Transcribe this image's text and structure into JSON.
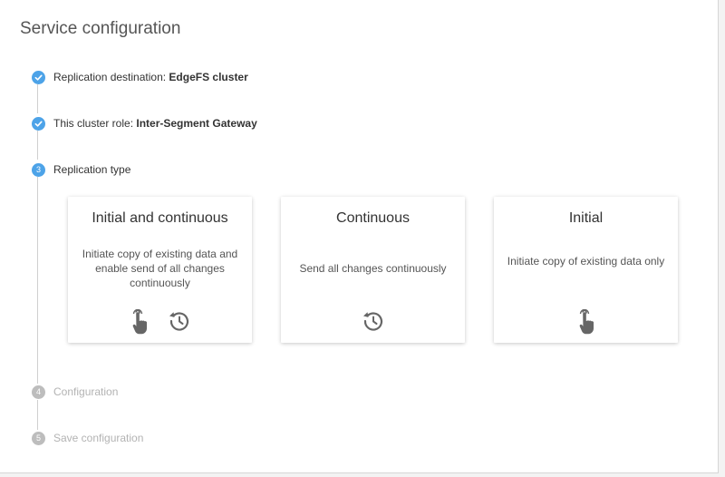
{
  "page": {
    "title": "Service configuration"
  },
  "steps": [
    {
      "number": "",
      "label": "Replication destination:",
      "value": "EdgeFS cluster",
      "state": "done"
    },
    {
      "number": "",
      "label": "This cluster role:",
      "value": "Inter-Segment Gateway",
      "state": "done"
    },
    {
      "number": "3",
      "label": "Replication type",
      "value": "",
      "state": "active"
    },
    {
      "number": "4",
      "label": "Configuration",
      "value": "",
      "state": "pending"
    },
    {
      "number": "5",
      "label": "Save configuration",
      "value": "",
      "state": "pending"
    }
  ],
  "options": [
    {
      "title": "Initial and continuous",
      "description": "Initiate copy of existing data and enable send of all changes continuously",
      "icons": [
        "touch-icon",
        "history-icon"
      ]
    },
    {
      "title": "Continuous",
      "description": "Send all changes continuously",
      "icons": [
        "history-icon"
      ]
    },
    {
      "title": "Initial",
      "description": "Initiate copy of existing data only",
      "icons": [
        "touch-icon"
      ]
    }
  ],
  "colors": {
    "accent": "#4da3e8",
    "pending": "#bdbdbd",
    "icon": "#666666"
  }
}
